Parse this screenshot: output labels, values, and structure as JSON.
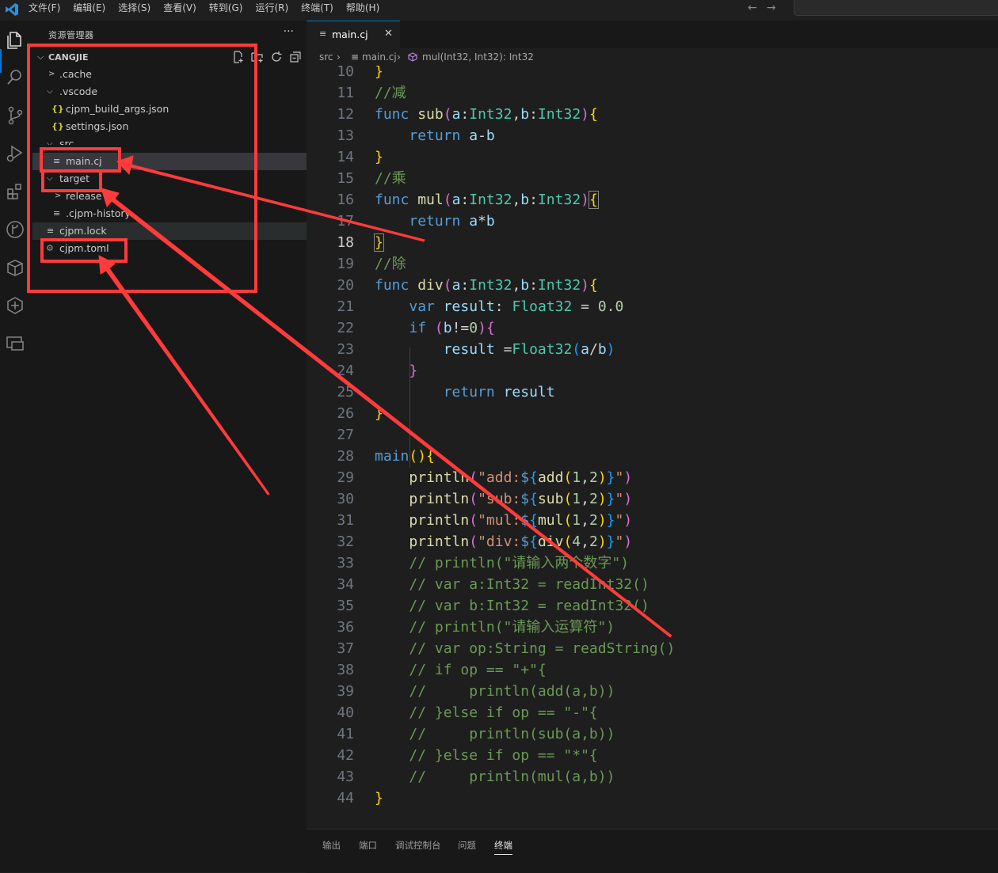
{
  "menu": [
    "文件(F)",
    "编辑(E)",
    "选择(S)",
    "查看(V)",
    "转到(G)",
    "运行(R)",
    "终端(T)",
    "帮助(H)"
  ],
  "sidebar": {
    "title": "资源管理器",
    "more": "···",
    "section": "CANGJIE",
    "tree": [
      {
        "name": ".cache"
      },
      {
        "name": ".vscode"
      },
      {
        "name": "cjpm_build_args.json"
      },
      {
        "name": "settings.json"
      },
      {
        "name": "src"
      },
      {
        "name": "main.cj"
      },
      {
        "name": "target"
      },
      {
        "name": "release"
      },
      {
        "name": ".cjpm-history"
      },
      {
        "name": "cjpm.lock"
      },
      {
        "name": "cjpm.toml"
      }
    ]
  },
  "tab": {
    "name": "main.cj",
    "close": "✕"
  },
  "breadcrumb": {
    "folder": "src",
    "file": "main.cj",
    "symbol": "mul(Int32, Int32): Int32"
  },
  "code": [
    {
      "n": "10",
      "t": "}"
    },
    {
      "n": "11",
      "t": "//减"
    },
    {
      "n": "12",
      "t": "func sub(a:Int32,b:Int32){"
    },
    {
      "n": "13",
      "t": "return a-b"
    },
    {
      "n": "14",
      "t": "}"
    },
    {
      "n": "15",
      "t": "//乘"
    },
    {
      "n": "16",
      "t": "func mul(a:Int32,b:Int32){"
    },
    {
      "n": "17",
      "t": "return a*b"
    },
    {
      "n": "18",
      "t": "}"
    },
    {
      "n": "19",
      "t": "//除"
    },
    {
      "n": "20",
      "t": "func div(a:Int32,b:Int32){"
    },
    {
      "n": "21",
      "t": "var result: Float32 = 0.0"
    },
    {
      "n": "22",
      "t": "if (b!=0){"
    },
    {
      "n": "23",
      "t": "result =Float32(a/b)"
    },
    {
      "n": "24",
      "t": "}"
    },
    {
      "n": "25",
      "t": "return result"
    },
    {
      "n": "26",
      "t": "}"
    },
    {
      "n": "27",
      "t": ""
    },
    {
      "n": "28",
      "t": "main(){"
    },
    {
      "n": "29",
      "t": "println(\"add:${add(1,2)}\")"
    },
    {
      "n": "30",
      "t": "println(\"sub:${sub(1,2)}\")"
    },
    {
      "n": "31",
      "t": "println(\"mul:${mul(1,2)}\")"
    },
    {
      "n": "32",
      "t": "println(\"div:${div(4,2)}\")"
    },
    {
      "n": "33",
      "t": "// println(\"请输入两个数字\")"
    },
    {
      "n": "34",
      "t": "// var a:Int32 = readInt32()"
    },
    {
      "n": "35",
      "t": "// var b:Int32 = readInt32()"
    },
    {
      "n": "36",
      "t": "// println(\"请输入运算符\")"
    },
    {
      "n": "37",
      "t": "// var op:String = readString()"
    },
    {
      "n": "38",
      "t": "// if op == \"+\"{"
    },
    {
      "n": "39",
      "t": "//     println(add(a,b))"
    },
    {
      "n": "40",
      "t": "// }else if op == \"-\"{"
    },
    {
      "n": "41",
      "t": "//     println(sub(a,b))"
    },
    {
      "n": "42",
      "t": "// }else if op == \"*\"{"
    },
    {
      "n": "43",
      "t": "//     println(mul(a,b))"
    },
    {
      "n": "44",
      "t": "}"
    }
  ],
  "panel_tabs": [
    "输出",
    "端口",
    "调试控制台",
    "问题",
    "终端"
  ],
  "colors": {
    "annotation": "#ff3b3b",
    "accent": "#0078d4"
  }
}
